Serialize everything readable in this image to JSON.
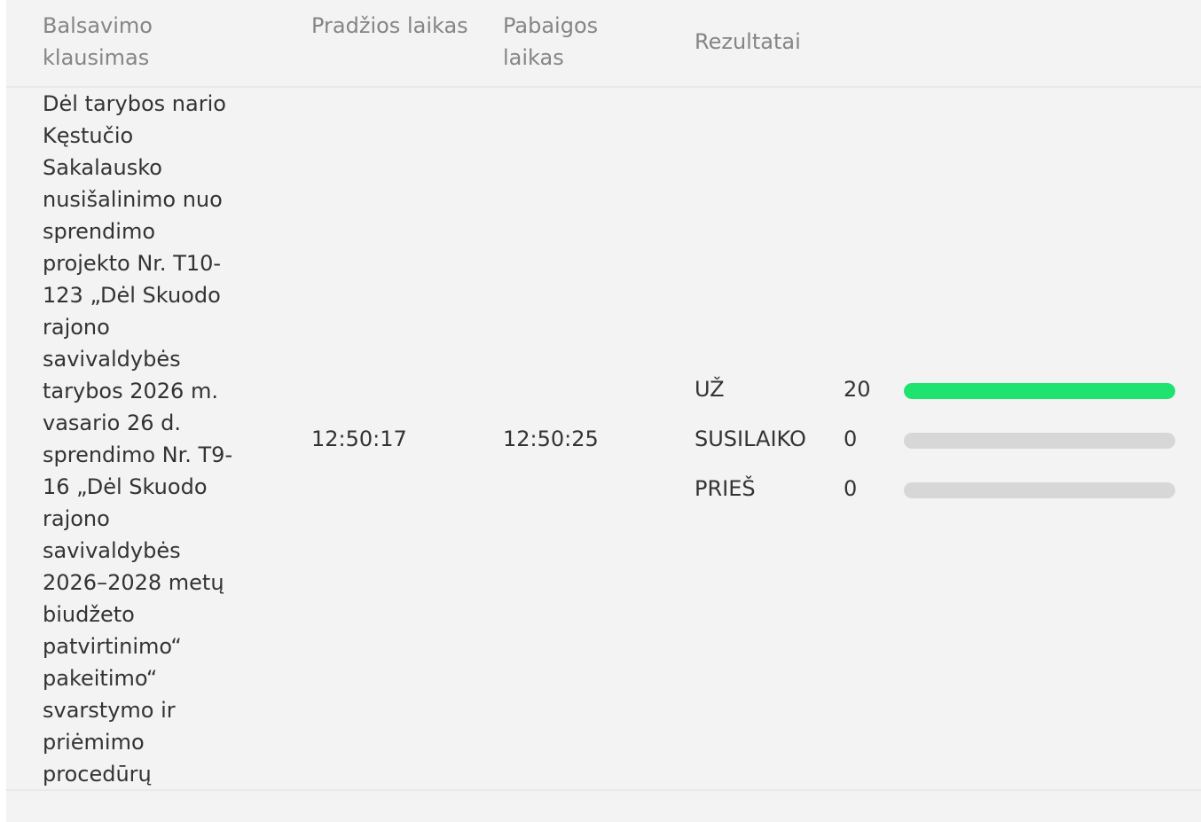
{
  "header": {
    "question": "Balsavimo klausimas",
    "start": "Pradžios laikas",
    "end": "Pabaigos laikas",
    "results": "Rezultatai"
  },
  "row": {
    "question": "Dėl tarybos nario Kęstučio Sakalausko nusišalinimo nuo sprendimo projekto Nr. T10-123 „Dėl Skuodo rajono savivaldybės tarybos 2026 m. vasario 26 d. sprendimo Nr. T9-16 „Dėl Skuodo rajono savivaldybės 2026–2028 metų biudžeto patvirtinimo“ pakeitimo“ svarstymo ir priėmimo procedūrų",
    "start_time": "12:50:17",
    "end_time": "12:50:25",
    "results": [
      {
        "label": "UŽ",
        "count": "20",
        "fill": 1.0,
        "color": "#1ee36f"
      },
      {
        "label": "SUSILAIKO",
        "count": "0",
        "fill": 0.0,
        "color": "#1ee36f"
      },
      {
        "label": "PRIEŠ",
        "count": "0",
        "fill": 0.0,
        "color": "#1ee36f"
      }
    ]
  },
  "colors": {
    "panel_bg": "#f2f3f2",
    "bar_track": "#d6d7d6",
    "bar_fill_for": "#1ee36f",
    "header_text": "#858585",
    "body_text": "#333333"
  }
}
